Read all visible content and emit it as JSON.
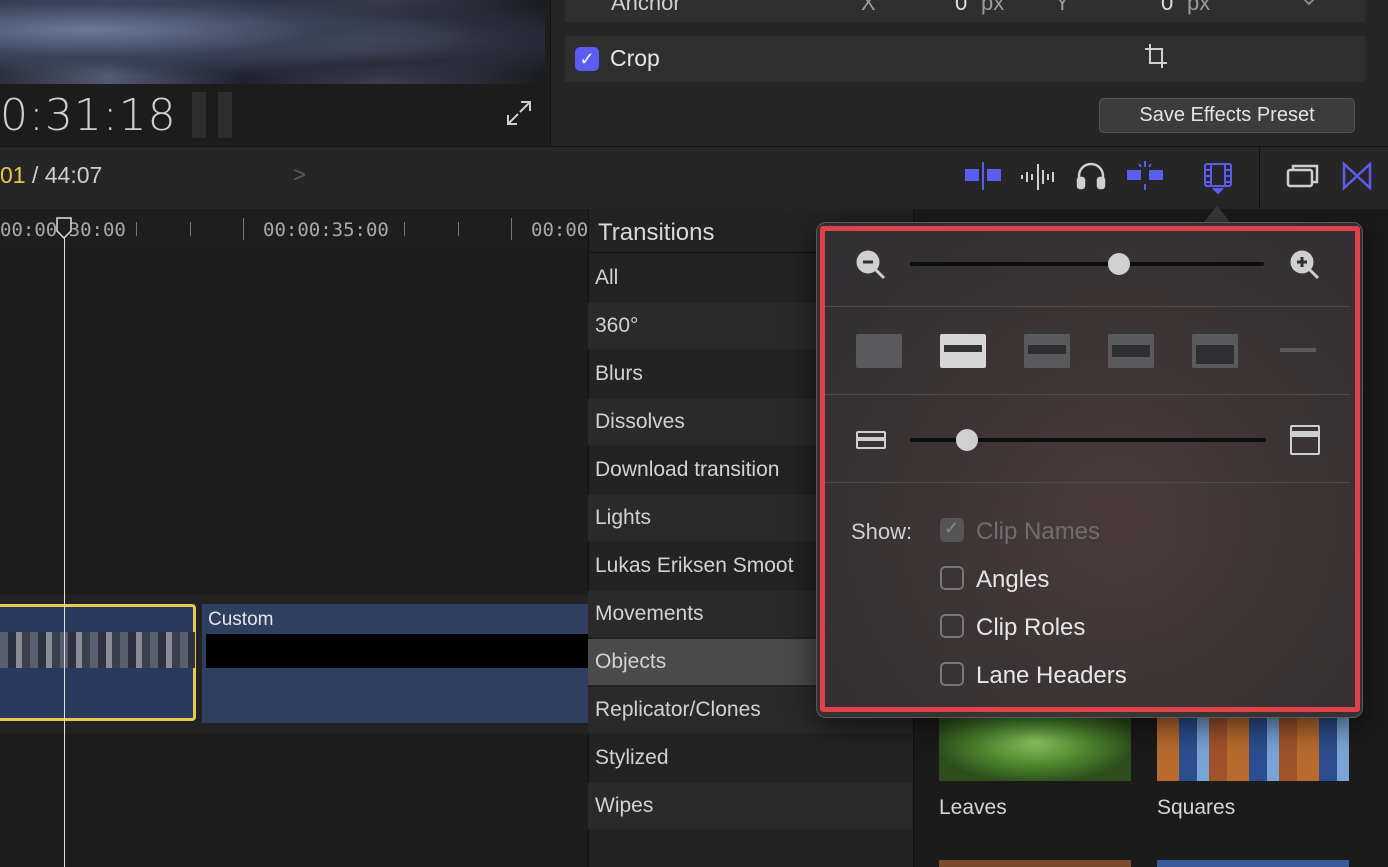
{
  "viewer": {
    "timecode": "0:31:18"
  },
  "inspector": {
    "anchor_label": "Anchor",
    "anchor_x_label": "X",
    "anchor_x_value": "0",
    "anchor_x_unit": "px",
    "anchor_y_label": "Y",
    "anchor_y_value": "0",
    "anchor_y_unit": "px",
    "crop_label": "Crop",
    "crop_checked": true,
    "save_preset_label": "Save Effects Preset"
  },
  "timeline": {
    "position_current": "01",
    "position_total": "/ 44:07",
    "ruler_labels": [
      "00:00:30:00",
      "00:00:35:00",
      "00:00"
    ],
    "clip_custom_label": "Custom"
  },
  "toolbar_icons": [
    "clip-skimming-icon",
    "audio-skimming-icon",
    "solo-headphones-icon",
    "snapping-icon",
    "clip-appearance-icon",
    "effects-browser-icon",
    "transitions-browser-icon"
  ],
  "browser": {
    "title": "Transitions",
    "categories": [
      "All",
      "360°",
      "Blurs",
      "Dissolves",
      "Download transition",
      "Lights",
      "Lukas Eriksen Smoot",
      "Movements",
      "Objects",
      "Replicator/Clones",
      "Stylized",
      "Wipes"
    ],
    "selected_category": "Objects",
    "thumbnails": [
      {
        "label": "Leaves"
      },
      {
        "label": "Squares"
      }
    ]
  },
  "clip_appearance_popover": {
    "zoom_level": 0.59,
    "clip_height": 0.16,
    "show_label": "Show:",
    "options": [
      {
        "label": "Clip Names",
        "checked": true,
        "disabled": true
      },
      {
        "label": "Angles",
        "checked": false,
        "disabled": false
      },
      {
        "label": "Clip Roles",
        "checked": false,
        "disabled": false
      },
      {
        "label": "Lane Headers",
        "checked": false,
        "disabled": false
      }
    ]
  },
  "colors": {
    "accent": "#5b5cf0",
    "highlight": "#e0404a",
    "selection": "#e8c94e"
  }
}
